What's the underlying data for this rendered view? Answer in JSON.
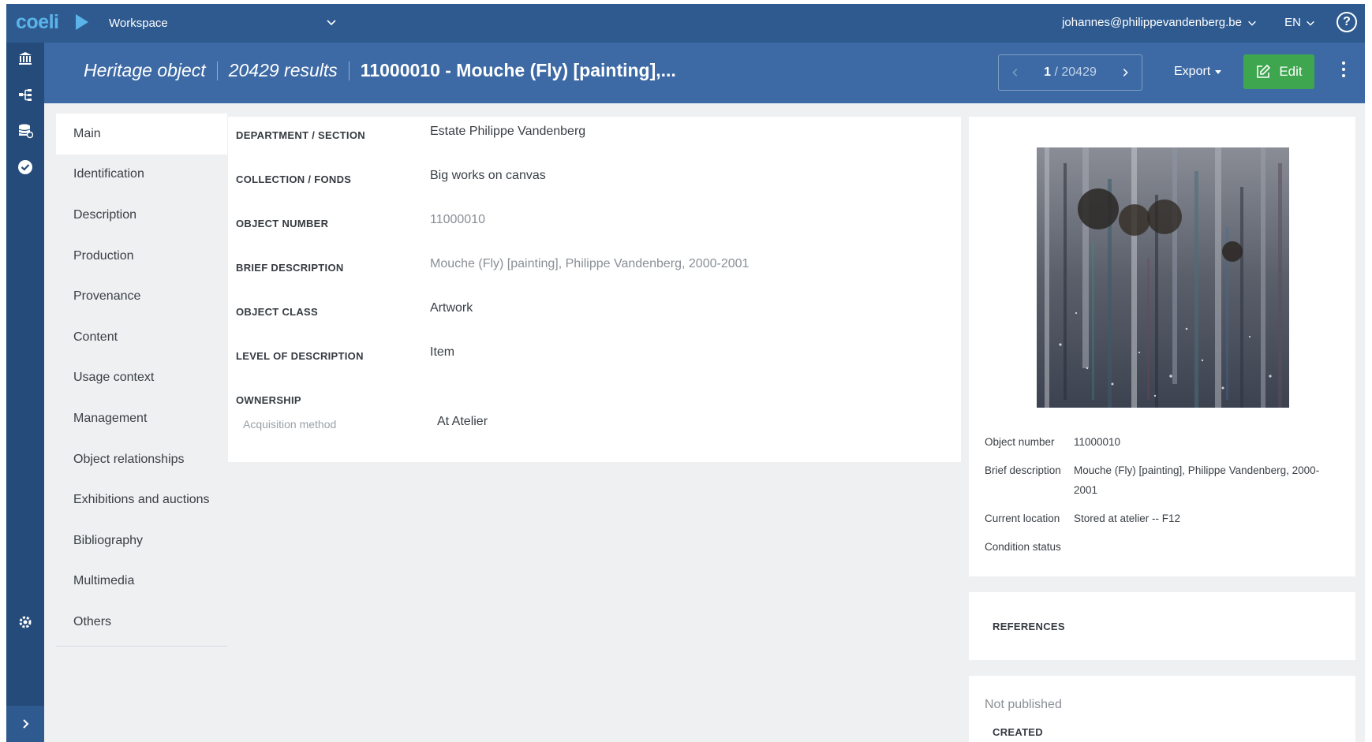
{
  "topbar": {
    "logo": "coeli",
    "workspace": "Workspace",
    "user": "johannes@philippevandenberg.be",
    "language": "EN",
    "help": "?"
  },
  "rail": {
    "icons": [
      "museum-icon",
      "hierarchy-icon",
      "database-icon",
      "check-circle-icon",
      "settings-icon",
      "expand-icon"
    ]
  },
  "header": {
    "record_type": "Heritage object",
    "results": "20429 results",
    "title": "11000010 - Mouche (Fly) [painting],...",
    "pager": {
      "current": "1",
      "total": "/ 20429"
    },
    "export_label": "Export",
    "edit_label": "Edit"
  },
  "sections": [
    "Main",
    "Identification",
    "Description",
    "Production",
    "Provenance",
    "Content",
    "Usage context",
    "Management",
    "Object relationships",
    "Exhibitions and auctions",
    "Bibliography",
    "Multimedia",
    "Others"
  ],
  "active_section": "Main",
  "fields": [
    {
      "label": "DEPARTMENT / SECTION",
      "value": "Estate Philippe Vandenberg"
    },
    {
      "label": "COLLECTION / FONDS",
      "value": "Big works on canvas"
    },
    {
      "label": "OBJECT NUMBER",
      "value": "11000010"
    },
    {
      "label": "BRIEF DESCRIPTION",
      "value": "Mouche (Fly) [painting], Philippe Vandenberg, 2000-2001"
    },
    {
      "label": "OBJECT CLASS",
      "value": "Artwork"
    },
    {
      "label": "LEVEL OF DESCRIPTION",
      "value": "Item"
    }
  ],
  "ownership": {
    "label": "OWNERSHIP",
    "sub_label": "Acquisition method",
    "sub_value": "At Atelier"
  },
  "summary": {
    "object_number_label": "Object number",
    "object_number": "11000010",
    "brief_description_label": "Brief description",
    "brief_description": "Mouche (Fly) [painting], Philippe Vandenberg, 2000-2001",
    "current_location_label": "Current location",
    "current_location": "Stored at atelier -- F12",
    "condition_status_label": "Condition status"
  },
  "references": {
    "title": "REFERENCES"
  },
  "publication": {
    "status": "Not published",
    "created_label": "CREATED"
  },
  "colors": {
    "topbar": "#2e5a8f",
    "headbar": "#3d6aa5",
    "rail": "#254b7a",
    "accent_logo": "#5ab4ea",
    "edit_button": "#3ea64f",
    "page_background": "#eef0f2"
  }
}
